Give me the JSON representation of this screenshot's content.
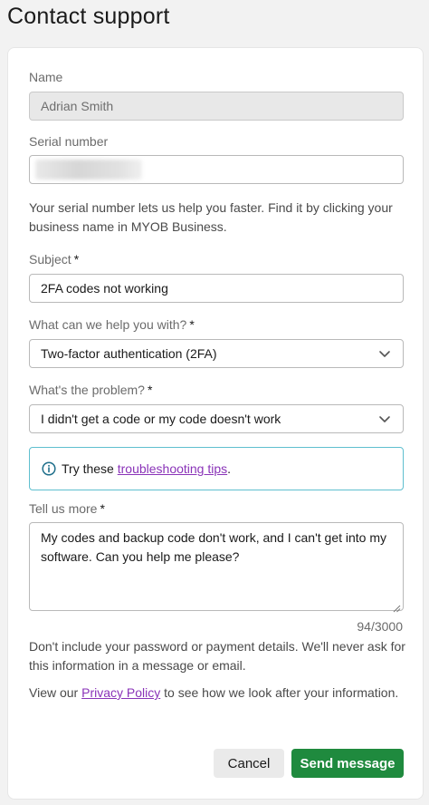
{
  "page": {
    "title": "Contact support"
  },
  "form": {
    "name": {
      "label": "Name",
      "value": "Adrian Smith"
    },
    "serial": {
      "label": "Serial number",
      "help": "Your serial number lets us help you faster. Find it by clicking your business name in MYOB Business."
    },
    "subject": {
      "label": "Subject",
      "required_mark": "*",
      "value": "2FA codes not working"
    },
    "help_with": {
      "label": "What can we help you with?",
      "required_mark": "*",
      "value": "Two-factor authentication (2FA)"
    },
    "problem": {
      "label": "What's the problem?",
      "required_mark": "*",
      "value": "I didn't get a code or my code doesn't work"
    },
    "tip": {
      "prefix": "Try these",
      "link": "troubleshooting tips",
      "suffix": "."
    },
    "more": {
      "label": "Tell us more",
      "required_mark": "*",
      "value": "My codes and backup code don't work, and I can't get into my software. Can you help me please?",
      "counter": "94/3000"
    },
    "notice": "Don't include your password or payment details. We'll never ask for this information in a message or email.",
    "privacy": {
      "prefix": "View our",
      "link": "Privacy Policy",
      "suffix": "to see how we look after your information."
    }
  },
  "actions": {
    "cancel": "Cancel",
    "send": "Send message"
  },
  "colors": {
    "accent": "#1f8a3e",
    "link": "#8a33b8",
    "info_border": "#5fbfcf"
  }
}
